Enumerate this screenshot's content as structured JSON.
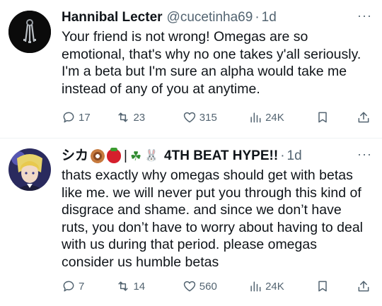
{
  "tweets": [
    {
      "name": "Hannibal Lecter",
      "handle": "@cucetinha69",
      "separator": "·",
      "time": "1d",
      "more": "···",
      "text": "Your friend is not wrong! Omegas are so emotional, that's why no one takes y'all seriously. I'm a beta but I'm sure an alpha would take me instead of any of you at anytime.",
      "replies": "17",
      "retweets": "23",
      "likes": "315",
      "views": "24K"
    },
    {
      "name": "シカ",
      "name_divider": "|",
      "name_suffix": "4TH BEAT HYPE!!",
      "separator": "·",
      "time": "1d",
      "more": "···",
      "text": "thats exactly why omegas should get with betas like me. we will never put you through this kind of disgrace and shame. and since we don’t have ruts, you don’t have to worry about having to deal with us during that period. please omegas consider us humble betas",
      "replies": "7",
      "retweets": "14",
      "likes": "560",
      "views": "24K",
      "name_emojis": [
        "donut-emoji",
        "strawberry-emoji",
        "clover-emoji",
        "rabbit-emoji"
      ]
    }
  ],
  "icons": [
    "reply-icon",
    "retweet-icon",
    "like-icon",
    "views-icon",
    "bookmark-icon",
    "share-icon"
  ]
}
